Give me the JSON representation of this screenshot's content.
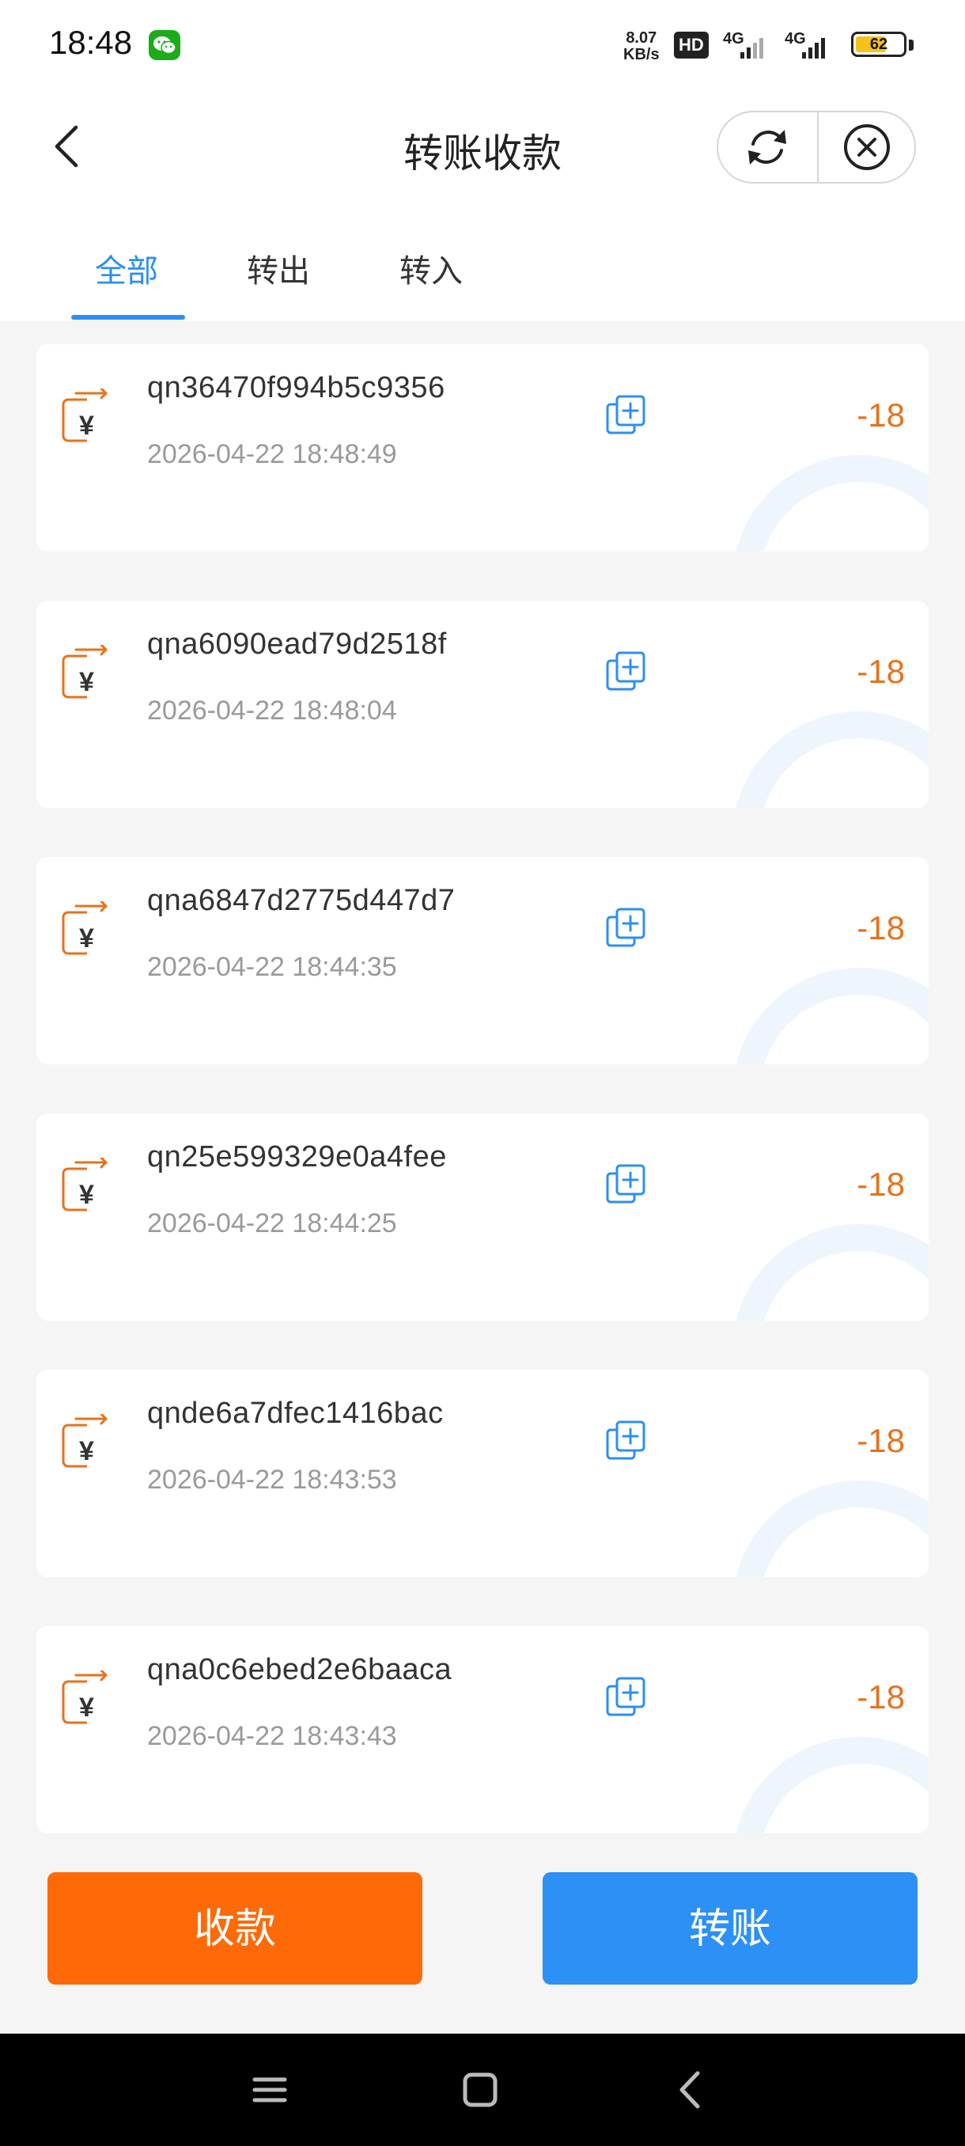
{
  "status_bar": {
    "time": "18:48",
    "speed_value": "8.07",
    "speed_unit": "KB/s",
    "hd_label": "HD",
    "net1": "4G",
    "net2": "4G",
    "battery": "62"
  },
  "header": {
    "title": "转账收款"
  },
  "tabs": [
    {
      "label": "全部",
      "active": true
    },
    {
      "label": "转出",
      "active": false
    },
    {
      "label": "转入",
      "active": false
    }
  ],
  "transactions": [
    {
      "id": "qn36470f994b5c9356",
      "time": "2026-04-22 18:48:49",
      "amount": "-18"
    },
    {
      "id": "qna6090ead79d2518f",
      "time": "2026-04-22 18:48:04",
      "amount": "-18"
    },
    {
      "id": "qna6847d2775d447d7",
      "time": "2026-04-22 18:44:35",
      "amount": "-18"
    },
    {
      "id": "qn25e599329e0a4fee",
      "time": "2026-04-22 18:44:25",
      "amount": "-18"
    },
    {
      "id": "qnde6a7dfec1416bac",
      "time": "2026-04-22 18:43:53",
      "amount": "-18"
    },
    {
      "id": "qna0c6ebed2e6baaca",
      "time": "2026-04-22 18:43:43",
      "amount": "-18"
    }
  ],
  "actions": {
    "receive_label": "收款",
    "transfer_label": "转账"
  },
  "colors": {
    "accent_blue": "#2c8ef8",
    "amount_orange": "#e8711b",
    "receive_button": "#fe6a08",
    "transfer_button": "#2c90f6"
  },
  "icons": {
    "transfer_item": "transfer-out-icon",
    "copy": "copy-icon",
    "refresh": "refresh-icon",
    "close": "close-circle-icon",
    "back": "back-arrow-icon"
  }
}
